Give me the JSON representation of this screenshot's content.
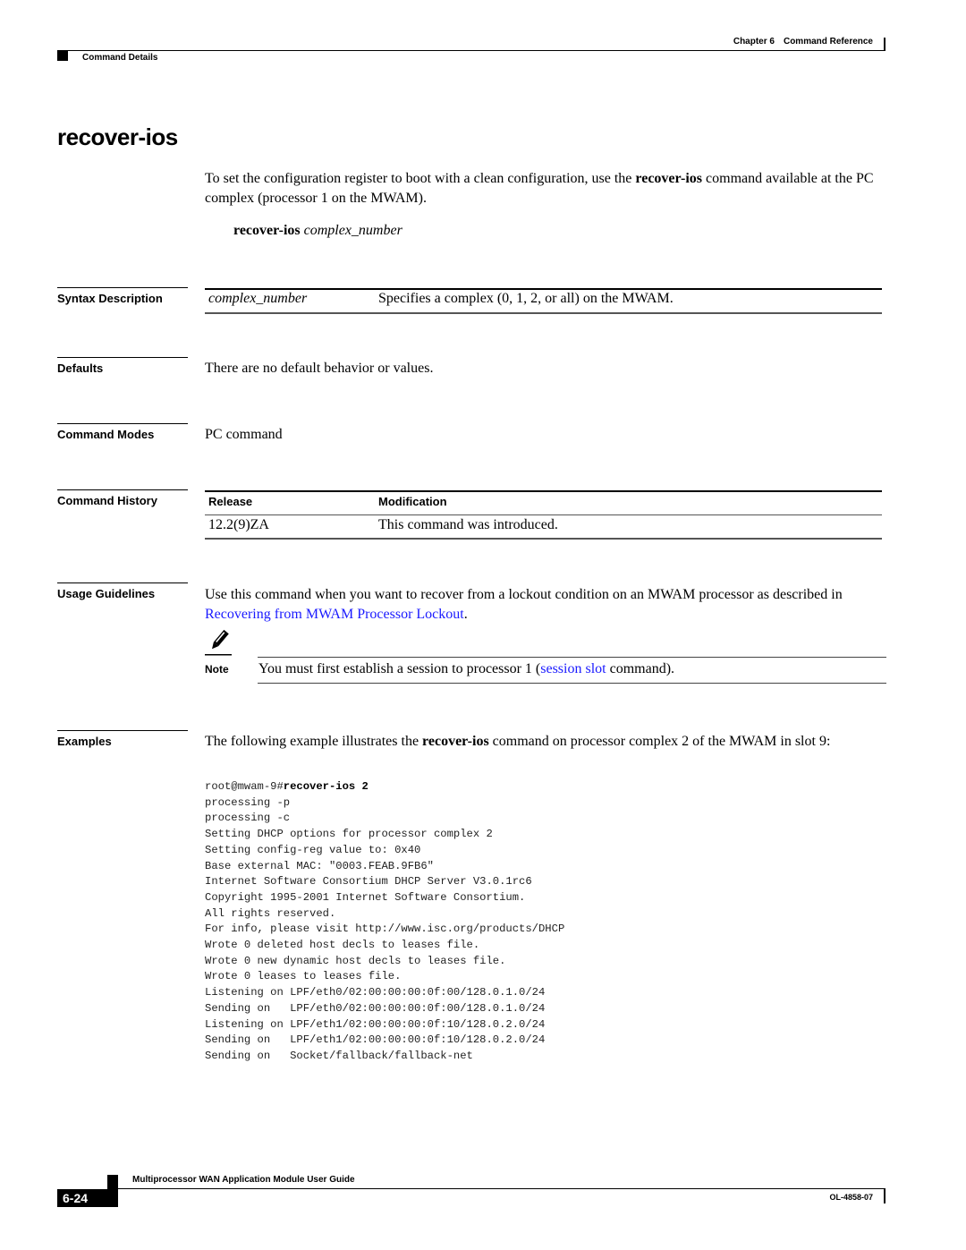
{
  "header": {
    "chapter": "Chapter 6",
    "chapter_title": "Command Reference",
    "section": "Command Details"
  },
  "title": "recover-ios",
  "intro": {
    "before": "To set the configuration register to boot with a clean configuration, use the ",
    "command": "recover-ios",
    "after": " command available at the PC complex (processor 1 on the MWAM)."
  },
  "syntax": {
    "command": "recover-ios",
    "argument": "complex_number"
  },
  "sections": {
    "syntax_description": {
      "label": "Syntax Description",
      "rows": [
        {
          "parameter": "complex_number",
          "description": "Specifies a complex (0, 1, 2, or all) on the MWAM."
        }
      ]
    },
    "defaults": {
      "label": "Defaults",
      "text": "There are no default behavior or values."
    },
    "command_modes": {
      "label": "Command Modes",
      "text": "PC command"
    },
    "command_history": {
      "label": "Command History",
      "columns": [
        "Release",
        "Modification"
      ],
      "rows": [
        {
          "release": "12.2(9)ZA",
          "modification": "This command was introduced."
        }
      ]
    },
    "usage_guidelines": {
      "label": "Usage Guidelines",
      "text_before": "Use this command when you want to recover from a lockout condition on an MWAM processor as described in ",
      "link": "Recovering from MWAM Processor Lockout",
      "text_after": ".",
      "note": {
        "label": "Note",
        "icon": "pencil-note-icon",
        "before": "You must first establish a session to processor 1 (",
        "link": "session slot",
        "after": " command)."
      }
    },
    "examples": {
      "label": "Examples",
      "before": "The following example illustrates the ",
      "command": "recover-ios",
      "after": " command on processor complex 2 of the MWAM in slot 9:",
      "prompt": "root@mwam-9#",
      "typed": "recover-ios 2",
      "output": [
        "processing -p",
        "processing -c",
        "Setting DHCP options for processor complex 2",
        "Setting config-reg value to: 0x40",
        "Base external MAC: \"0003.FEAB.9FB6\"",
        "Internet Software Consortium DHCP Server V3.0.1rc6",
        "Copyright 1995-2001 Internet Software Consortium.",
        "All rights reserved.",
        "For info, please visit http://www.isc.org/products/DHCP",
        "Wrote 0 deleted host decls to leases file.",
        "Wrote 0 new dynamic host decls to leases file.",
        "Wrote 0 leases to leases file.",
        "Listening on LPF/eth0/02:00:00:00:0f:00/128.0.1.0/24",
        "Sending on   LPF/eth0/02:00:00:00:0f:00/128.0.1.0/24",
        "Listening on LPF/eth1/02:00:00:00:0f:10/128.0.2.0/24",
        "Sending on   LPF/eth1/02:00:00:00:0f:10/128.0.2.0/24",
        "Sending on   Socket/fallback/fallback-net"
      ]
    }
  },
  "footer": {
    "guide_title": "Multiprocessor WAN Application Module User Guide",
    "page_number": "6-24",
    "doc_number": "OL-4858-07"
  },
  "colors": {
    "link": "#1a1aff",
    "text": "#000000"
  }
}
